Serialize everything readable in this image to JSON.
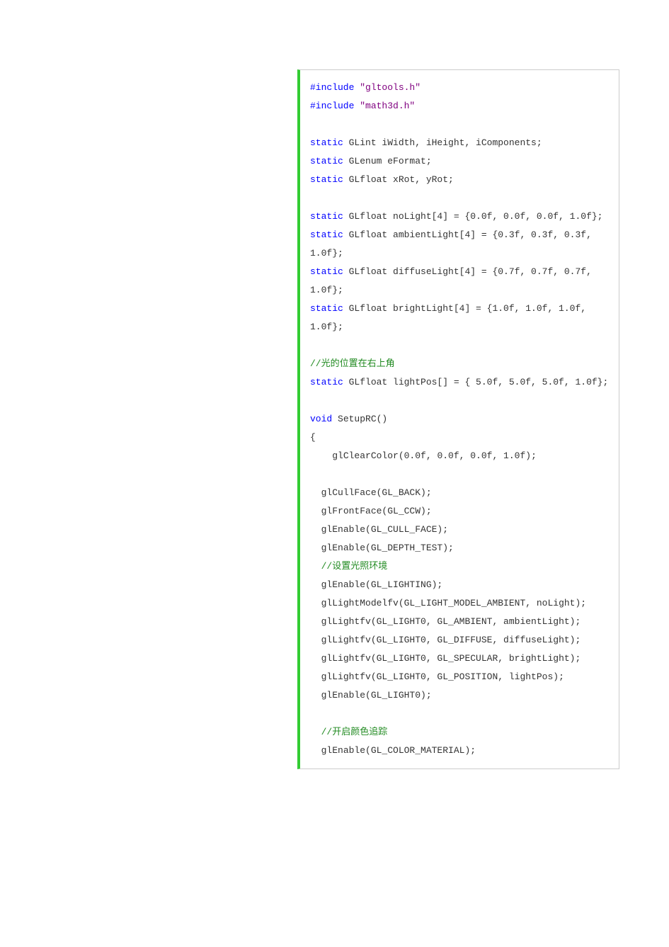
{
  "code": {
    "lines": [
      [
        {
          "text": "#include ",
          "cls": "kw-blue"
        },
        {
          "text": "\"gltools.h\"",
          "cls": "str-purple"
        }
      ],
      [
        {
          "text": "#include ",
          "cls": "kw-blue"
        },
        {
          "text": "\"math3d.h\"",
          "cls": "str-purple"
        }
      ],
      [
        {
          "text": " ",
          "cls": ""
        }
      ],
      [
        {
          "text": "static",
          "cls": "kw-blue"
        },
        {
          "text": " GLint iWidth, iHeight, iComponents;",
          "cls": ""
        }
      ],
      [
        {
          "text": "static",
          "cls": "kw-blue"
        },
        {
          "text": " GLenum eFormat;",
          "cls": ""
        }
      ],
      [
        {
          "text": "static",
          "cls": "kw-blue"
        },
        {
          "text": " GLfloat xRot, yRot;",
          "cls": ""
        }
      ],
      [
        {
          "text": " ",
          "cls": ""
        }
      ],
      [
        {
          "text": "static",
          "cls": "kw-blue"
        },
        {
          "text": " GLfloat noLight[4] = {0.0f, 0.0f, 0.0f, 1.0f};",
          "cls": ""
        }
      ],
      [
        {
          "text": "static",
          "cls": "kw-blue"
        },
        {
          "text": " GLfloat ambientLight[4] = {0.3f, 0.3f, 0.3f, 1.0f};",
          "cls": ""
        }
      ],
      [
        {
          "text": "static",
          "cls": "kw-blue"
        },
        {
          "text": " GLfloat diffuseLight[4] = {0.7f, 0.7f, 0.7f, 1.0f};",
          "cls": ""
        }
      ],
      [
        {
          "text": "static",
          "cls": "kw-blue"
        },
        {
          "text": " GLfloat brightLight[4] = {1.0f, 1.0f, 1.0f, 1.0f};",
          "cls": ""
        }
      ],
      [
        {
          "text": " ",
          "cls": ""
        }
      ],
      [
        {
          "text": "//光的位置在右上角",
          "cls": "comment-green"
        }
      ],
      [
        {
          "text": "static",
          "cls": "kw-blue"
        },
        {
          "text": " GLfloat lightPos[] = { 5.0f, 5.0f, 5.0f, 1.0f};",
          "cls": ""
        }
      ],
      [
        {
          "text": " ",
          "cls": ""
        }
      ],
      [
        {
          "text": "void",
          "cls": "kw-blue"
        },
        {
          "text": " SetupRC()",
          "cls": ""
        }
      ],
      [
        {
          "text": "{",
          "cls": ""
        }
      ],
      [
        {
          "text": "    glClearColor(0.0f, 0.0f, 0.0f, 1.0f);",
          "cls": ""
        }
      ],
      [
        {
          "text": " ",
          "cls": ""
        }
      ],
      [
        {
          "text": "  glCullFace(GL_BACK);",
          "cls": ""
        }
      ],
      [
        {
          "text": "  glFrontFace(GL_CCW);",
          "cls": ""
        }
      ],
      [
        {
          "text": "  glEnable(GL_CULL_FACE);",
          "cls": ""
        }
      ],
      [
        {
          "text": "  glEnable(GL_DEPTH_TEST);",
          "cls": ""
        }
      ],
      [
        {
          "text": "  ",
          "cls": ""
        },
        {
          "text": "//设置光照环境",
          "cls": "comment-green"
        }
      ],
      [
        {
          "text": "  glEnable(GL_LIGHTING);",
          "cls": ""
        }
      ],
      [
        {
          "text": "  glLightModelfv(GL_LIGHT_MODEL_AMBIENT, noLight);",
          "cls": ""
        }
      ],
      [
        {
          "text": "  glLightfv(GL_LIGHT0, GL_AMBIENT, ambientLight);",
          "cls": ""
        }
      ],
      [
        {
          "text": "  glLightfv(GL_LIGHT0, GL_DIFFUSE, diffuseLight);",
          "cls": ""
        }
      ],
      [
        {
          "text": "  glLightfv(GL_LIGHT0, GL_SPECULAR, brightLight);",
          "cls": ""
        }
      ],
      [
        {
          "text": "  glLightfv(GL_LIGHT0, GL_POSITION, lightPos);",
          "cls": ""
        }
      ],
      [
        {
          "text": "  glEnable(GL_LIGHT0);",
          "cls": ""
        }
      ],
      [
        {
          "text": " ",
          "cls": ""
        }
      ],
      [
        {
          "text": "  ",
          "cls": ""
        },
        {
          "text": "//开启颜色追踪",
          "cls": "comment-green"
        }
      ],
      [
        {
          "text": "  glEnable(GL_COLOR_MATERIAL);",
          "cls": ""
        }
      ]
    ]
  }
}
